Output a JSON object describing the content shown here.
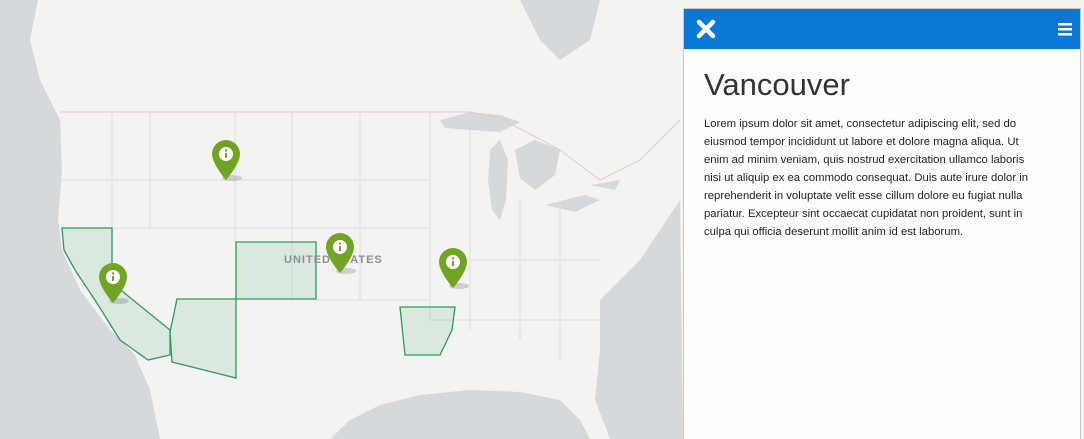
{
  "map": {
    "country_label": "UNITED STATES",
    "highlight_color": "#2e9b5b",
    "marker_color": "#6fa523",
    "markers": [
      {
        "name": "marker-montana",
        "icon": "info-icon"
      },
      {
        "name": "marker-kansas",
        "icon": "info-icon"
      },
      {
        "name": "marker-california",
        "icon": "info-icon"
      },
      {
        "name": "marker-illinois",
        "icon": "info-icon"
      }
    ]
  },
  "panel": {
    "header_color": "#0a78d7",
    "close_icon": "close-icon",
    "menu_icon": "hamburger-menu-icon",
    "title": "Vancouver",
    "body": "Lorem ipsum dolor sit amet, consectetur adipiscing elit, sed do eiusmod tempor incididunt ut labore et dolore magna aliqua. Ut enim ad minim veniam, quis nostrud exercitation ullamco laboris nisi ut aliquip ex ea commodo consequat. Duis aute irure dolor in reprehenderit in voluptate velit esse cillum dolore eu fugiat nulla pariatur. Excepteur sint occaecat cupidatat non proident, sunt in culpa qui officia deserunt mollit anim id est laborum."
  }
}
